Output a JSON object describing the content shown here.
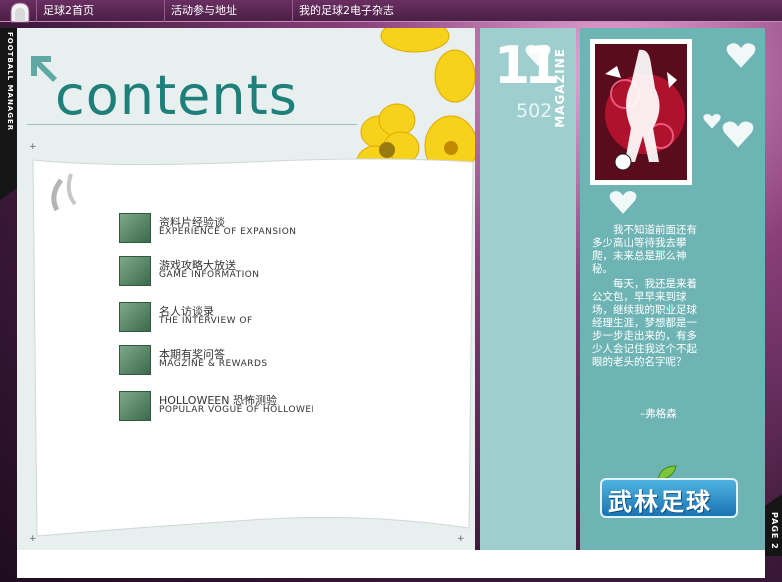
{
  "nav": {
    "items": [
      {
        "label": "足球2首页"
      },
      {
        "label": "活动参与地址"
      },
      {
        "label": "我的足球2电子杂志"
      }
    ]
  },
  "side": {
    "left_label": "FOOTBALL MANAGER",
    "right_label": "PAGE 2"
  },
  "contents": {
    "title": "contents",
    "items": [
      {
        "cn": "资料片经验谈",
        "en": "EXPERIENCE OF EXPANSION"
      },
      {
        "cn": "游戏攻略大放送",
        "en": "GAME INFORMATION"
      },
      {
        "cn": "名人访谈录",
        "en": "THE INTERVIEW OF"
      },
      {
        "cn": "本期有奖问答",
        "en": "MAGZINE & REWARDS"
      },
      {
        "cn": "HOLLOWEEN 恐怖测验",
        "en": "POPULAR VOGUE OF HOLLOWEEN"
      }
    ]
  },
  "magazine": {
    "issue": "11",
    "number": "502",
    "label": "MAGAZINE"
  },
  "story": {
    "paragraph1": "我不知道前面还有多少高山等待我去攀爬，未来总是那么神秘。",
    "paragraph2": "每天，我还是来着公文包，早早来到球场，继续我的职业足球经理生涯，梦想都是一步一步走出来的，有多少人会记住我这个不起眼的老头的名字呢？",
    "signature": "–弗格森"
  },
  "logo": {
    "text": "武林足球"
  },
  "colors": {
    "title_teal": "#1f7f7b",
    "magazine_column": "#9fcecf",
    "story_column": "#6fb4b5",
    "panel_bg": "#e8f0ef"
  }
}
